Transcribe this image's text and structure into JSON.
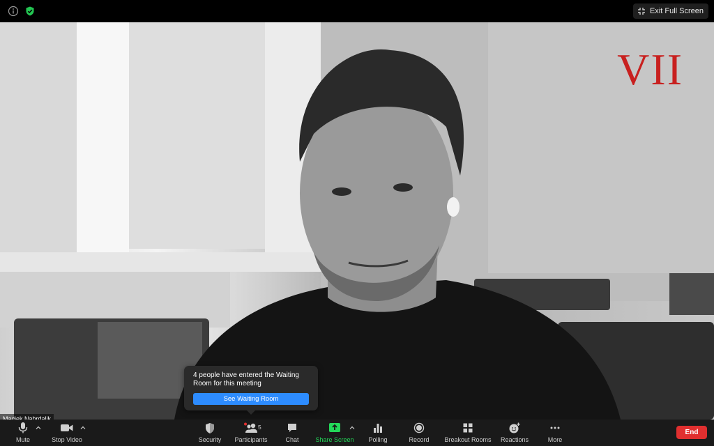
{
  "top_bar": {
    "info_icon": "info-icon",
    "security_icon": "shield-check-icon",
    "exit_fullscreen_label": "Exit Full Screen"
  },
  "video": {
    "participant_name": "Maciek Nabrdalik",
    "watermark_logo": "VII",
    "watermark_color": "#c8201f"
  },
  "waiting_room_popup": {
    "message": "4 people have entered the Waiting Room for this meeting",
    "button_label": "See Waiting Room",
    "button_color": "#2d8cff"
  },
  "toolbar": {
    "mute_label": "Mute",
    "stop_video_label": "Stop Video",
    "security_label": "Security",
    "participants_label": "Participants",
    "participants_count": "5",
    "chat_label": "Chat",
    "share_screen_label": "Share Screen",
    "share_screen_color": "#23d959",
    "polling_label": "Polling",
    "record_label": "Record",
    "breakout_rooms_label": "Breakout Rooms",
    "reactions_label": "Reactions",
    "more_label": "More",
    "end_label": "End",
    "end_color": "#e02f2f"
  }
}
